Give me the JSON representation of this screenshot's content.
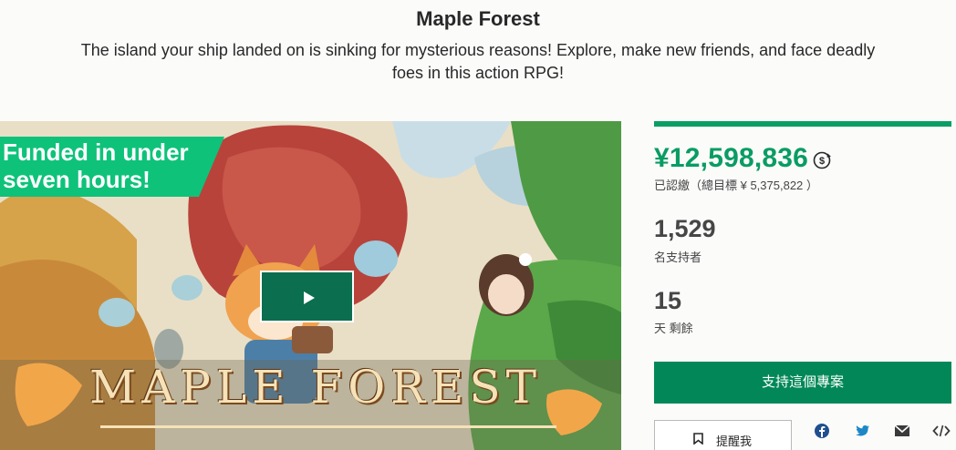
{
  "project": {
    "title": "Maple Forest",
    "blurb": "The island your ship landed on is sinking for mysterious reasons! Explore, make new friends, and face deadly foes in this action RPG!"
  },
  "media": {
    "funded_badge": "Funded in under seven hours!",
    "logo_text": "MAPLE FOREST",
    "play_icon": "play-icon"
  },
  "stats": {
    "progress_fraction": 1.0,
    "pledged": "¥12,598,836",
    "pledged_label": "已認繳（總目標 ¥ 5,375,822 ）",
    "backers": "1,529",
    "backers_label": "名支持者",
    "days": "15",
    "days_label": "天 剩餘"
  },
  "actions": {
    "back_label": "支持這個專案",
    "remind_label": "提醒我",
    "share_icons": [
      "facebook-icon",
      "twitter-icon",
      "email-icon",
      "embed-icon"
    ]
  },
  "colors": {
    "accent": "#028858",
    "pledged": "#099c63",
    "funded_badge": "#0ec27a"
  }
}
